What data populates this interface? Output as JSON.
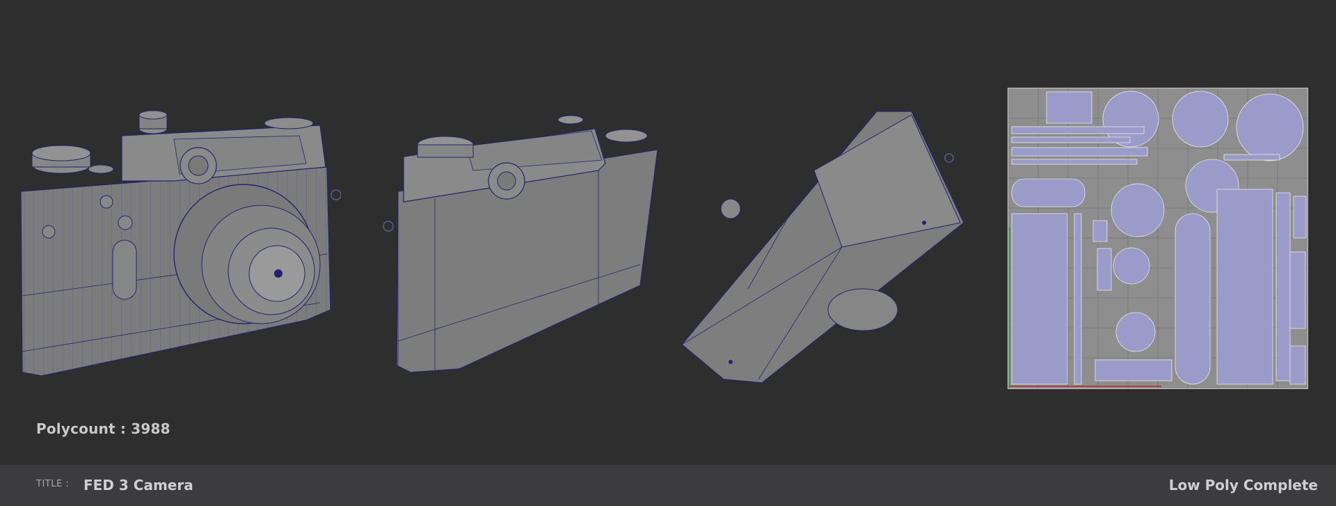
{
  "polycount": {
    "label": "Polycount : 3988"
  },
  "footer": {
    "title_label": "TITLE :",
    "title_value": "FED 3 Camera",
    "status": "Low Poly Complete"
  },
  "views": [
    "camera-front-three-quarter",
    "camera-back-three-quarter",
    "camera-bottom-view",
    "uv-layout"
  ],
  "colors": {
    "background": "#2e2e2e",
    "footer": "#3c3c3e",
    "mesh": "#7d7d7d",
    "wire": "#2a2a7a",
    "uv_shell": "#9a9ac8"
  }
}
